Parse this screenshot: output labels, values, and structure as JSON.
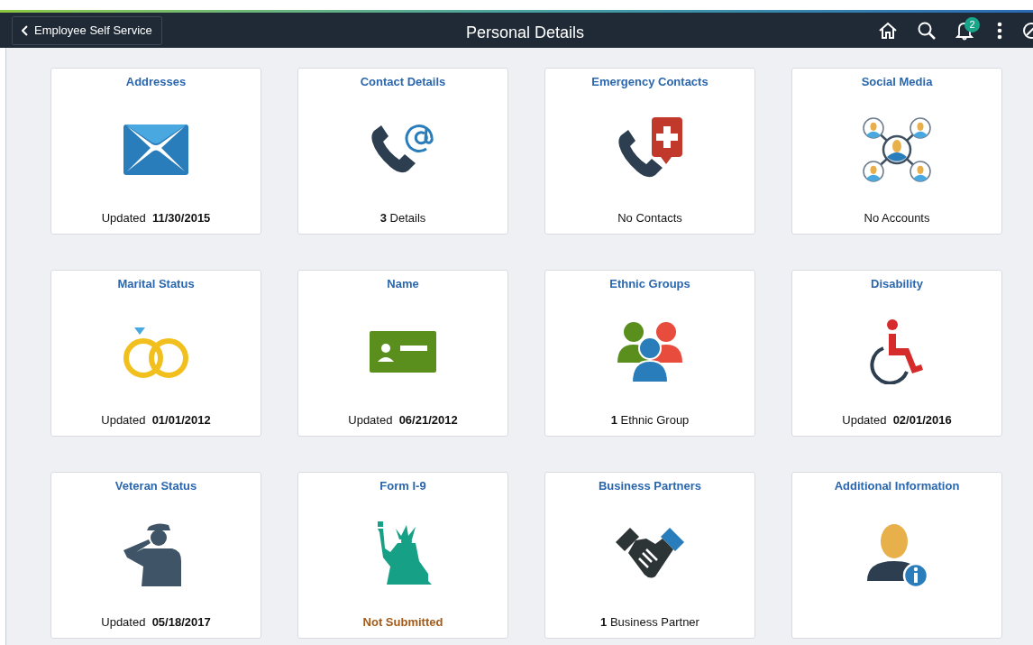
{
  "header": {
    "back_button": "Employee Self Service",
    "title": "Personal Details",
    "notification_count": "2"
  },
  "tiles": [
    {
      "title": "Addresses",
      "kind": "normal",
      "footer": "Updated  **11/30/2015**"
    },
    {
      "title": "Contact Details",
      "kind": "normal",
      "footer": "**3** Details"
    },
    {
      "title": "Emergency Contacts",
      "kind": "normal",
      "footer": "No Contacts"
    },
    {
      "title": "Social Media",
      "kind": "normal",
      "footer": "No Accounts"
    },
    {
      "title": "Marital Status",
      "kind": "normal",
      "footer": "Updated  **01/01/2012**"
    },
    {
      "title": "Name",
      "kind": "normal",
      "footer": "Updated  **06/21/2012**"
    },
    {
      "title": "Ethnic Groups",
      "kind": "normal",
      "footer": "**1** Ethnic Group"
    },
    {
      "title": "Disability",
      "kind": "normal",
      "footer": "Updated  **02/01/2016**"
    },
    {
      "title": "Veteran Status",
      "kind": "normal",
      "footer": "Updated  **05/18/2017**"
    },
    {
      "title": "Form I-9",
      "kind": "alert",
      "footer": "Not Submitted"
    },
    {
      "title": "Business Partners",
      "kind": "normal",
      "footer": "**1** Business Partner"
    },
    {
      "title": "Additional Information"
    }
  ]
}
